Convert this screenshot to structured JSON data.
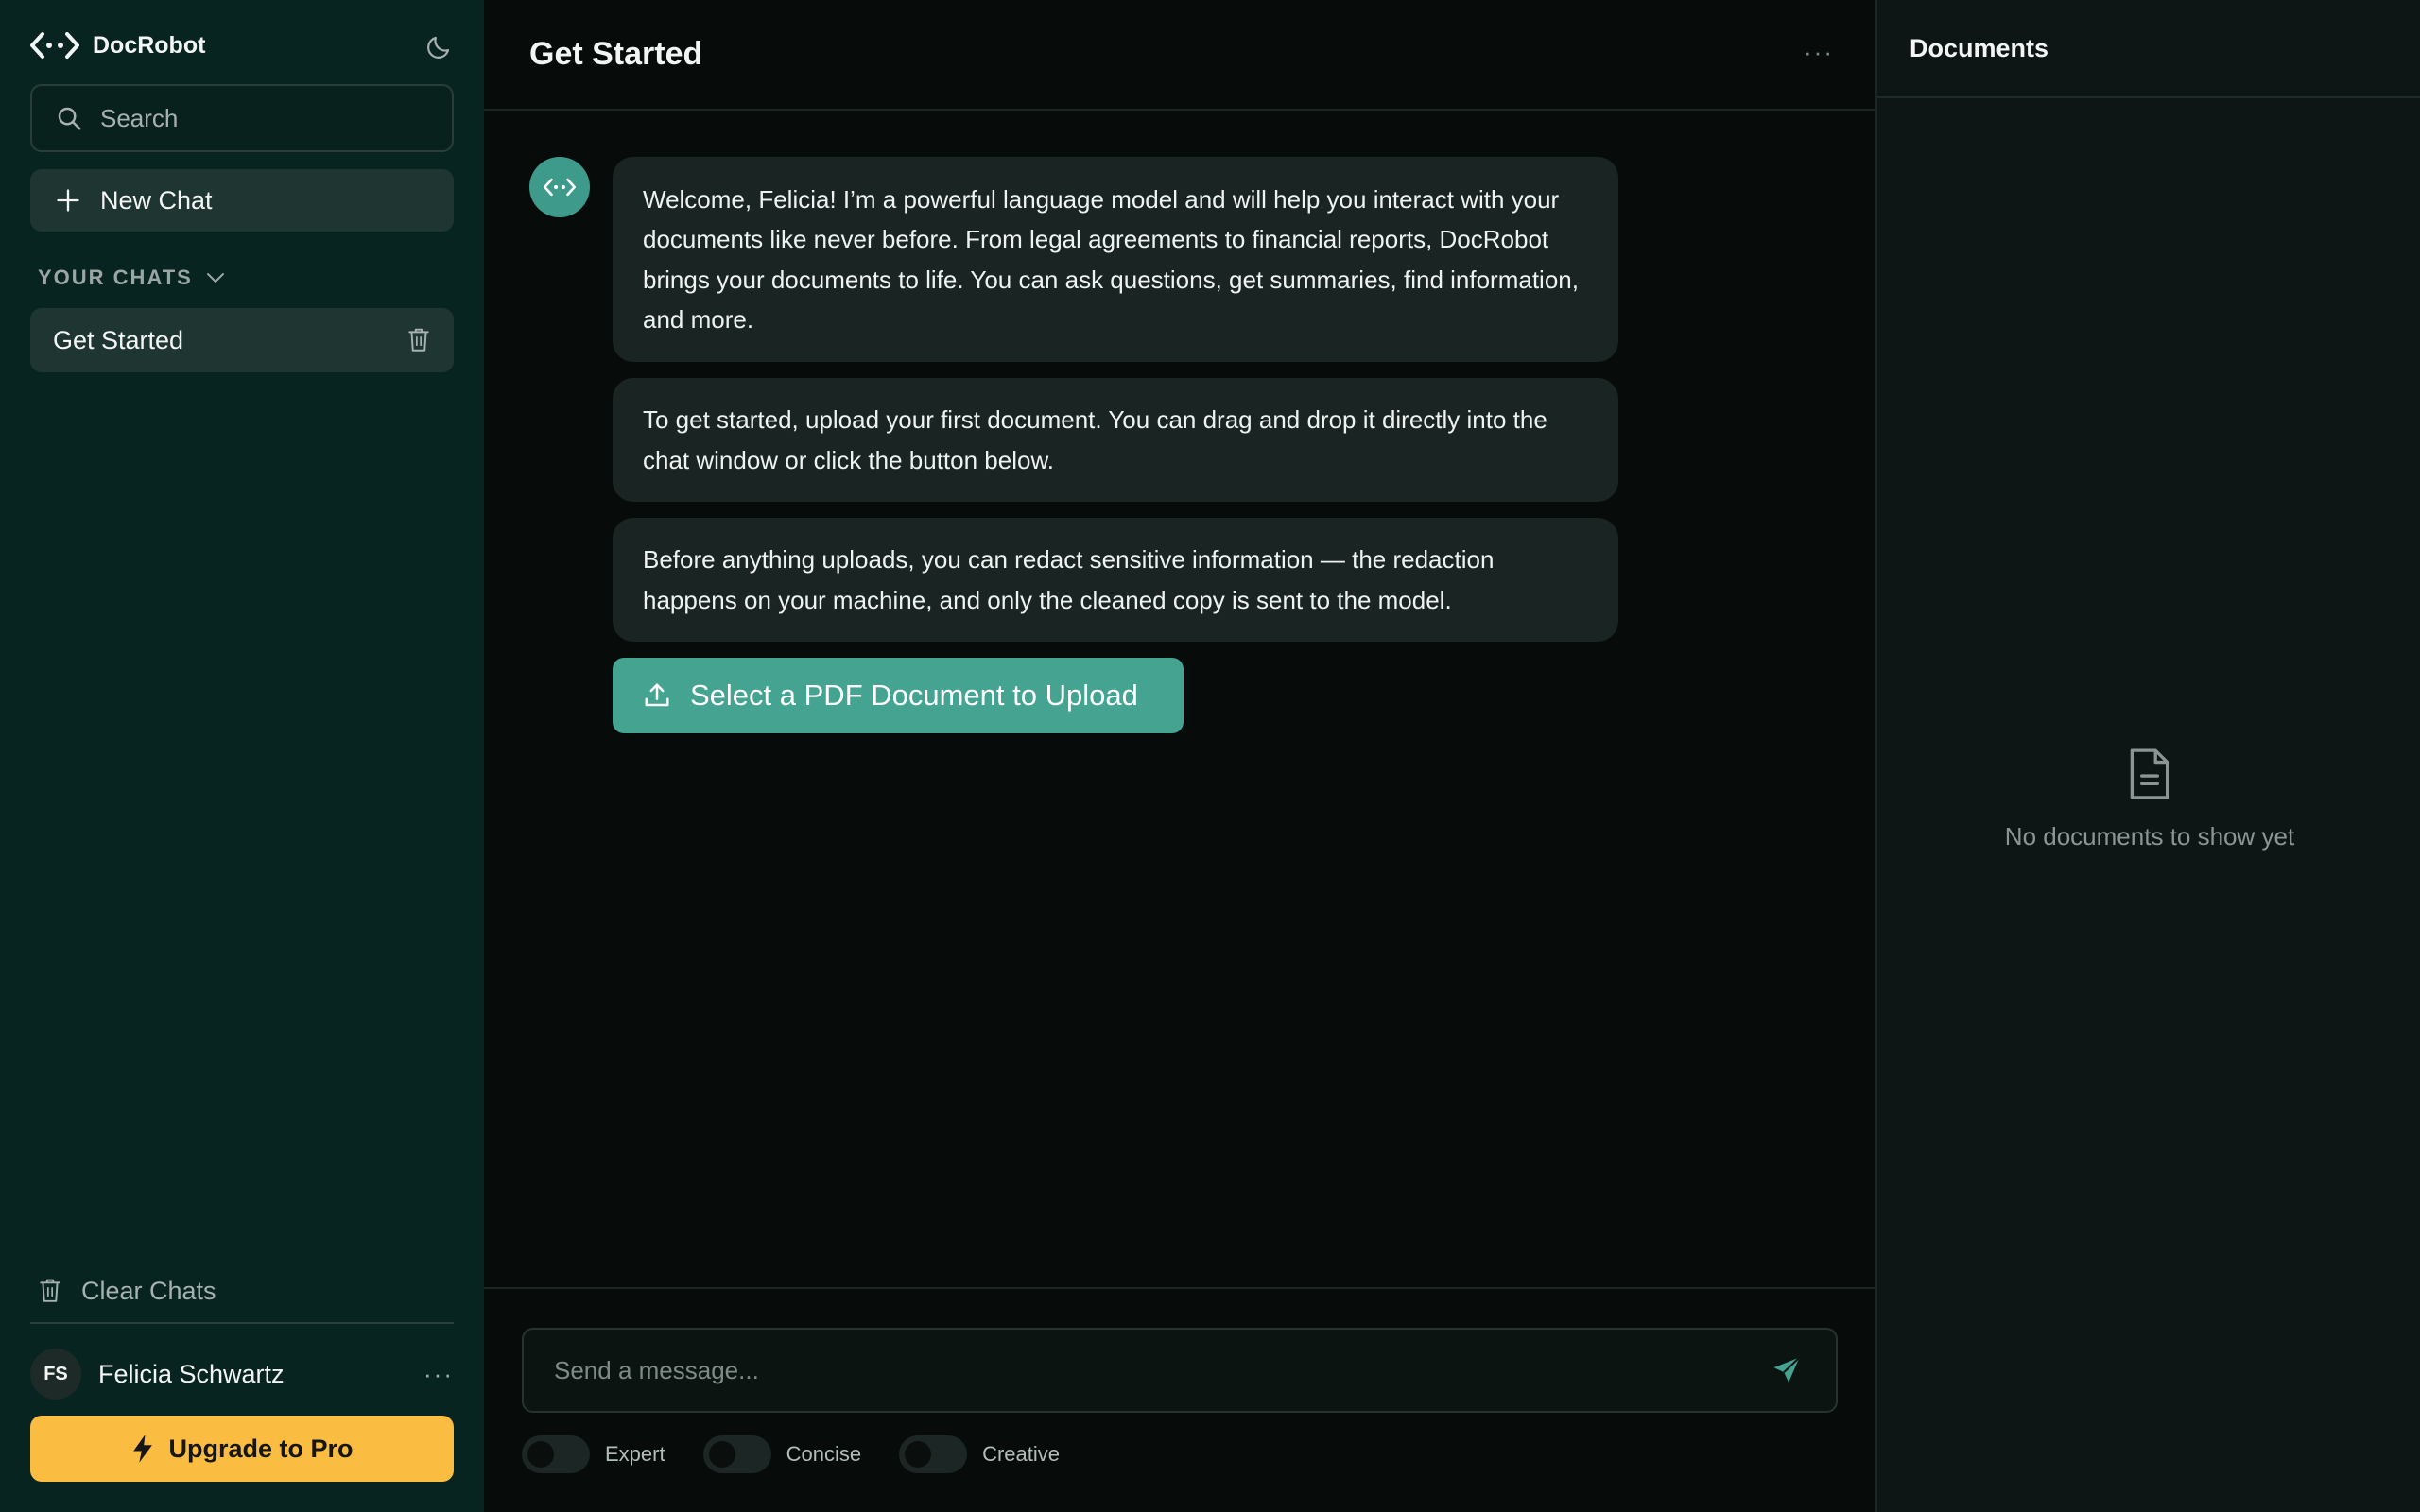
{
  "app": {
    "name": "DocRobot"
  },
  "sidebar": {
    "search": {
      "placeholder": "Search",
      "value": ""
    },
    "new_chat_label": "New Chat",
    "chats_section_label": "YOUR CHATS",
    "chats": [
      {
        "label": "Get Started",
        "active": true
      }
    ],
    "clear_chats_label": "Clear Chats",
    "user": {
      "initials": "FS",
      "name": "Felicia Schwartz"
    },
    "upgrade_label": "Upgrade to Pro"
  },
  "main": {
    "title": "Get Started",
    "messages": [
      {
        "text": "Welcome, Felicia! I’m a powerful language model and will help you interact with your documents like never before. From legal agreements to financial reports, DocRobot brings your documents to life. You can ask questions, get summaries, find information, and more."
      },
      {
        "text": "To get started, upload your first document. You can drag and drop it directly into the chat window or click the button below."
      },
      {
        "text": "Before anything uploads, you can redact sensitive information — the redaction happens on your machine, and only the cleaned copy is sent to the model."
      }
    ],
    "upload_label": "Select a PDF Document to Upload",
    "composer": {
      "placeholder": "Send a message...",
      "value": ""
    },
    "toggles": [
      {
        "label": "Expert",
        "on": false
      },
      {
        "label": "Concise",
        "on": false
      },
      {
        "label": "Creative",
        "on": false
      }
    ]
  },
  "documents": {
    "title": "Documents",
    "empty_text": "No documents to show yet"
  },
  "colors": {
    "sidebar_bg": "#072420",
    "main_bg": "#070c0b",
    "bubble_bg": "#1a2422",
    "accent": "#45a391",
    "upgrade": "#fbbd41",
    "docs_bg": "#0d1615"
  }
}
